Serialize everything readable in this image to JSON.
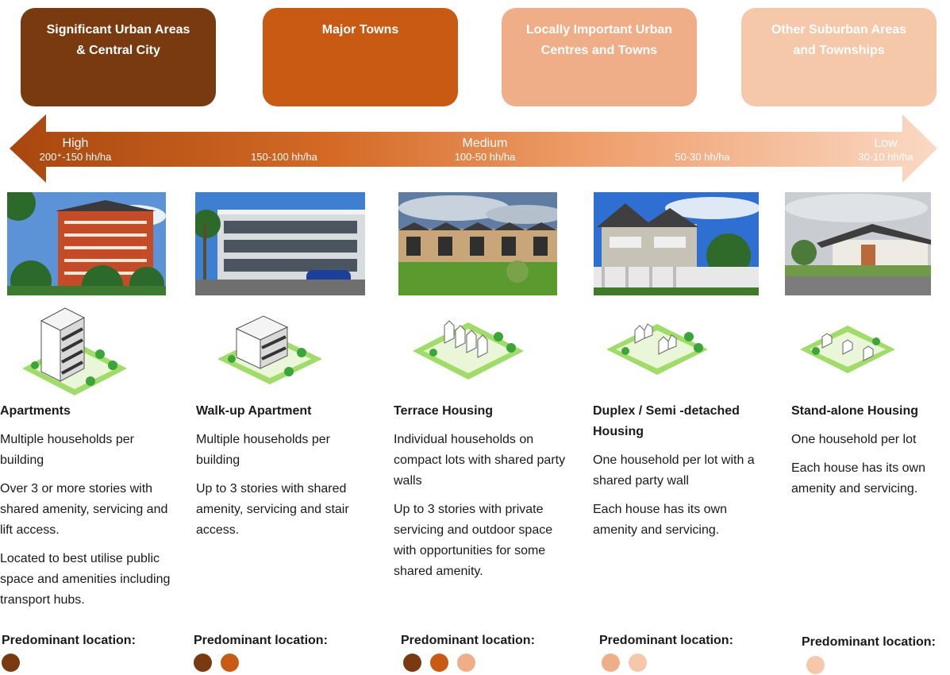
{
  "colors": {
    "significant": "#7a3a10",
    "major": "#c85a14",
    "locally": "#f0ae88",
    "other": "#f6c8aa"
  },
  "categories": [
    {
      "line1": "Significant Urban Areas",
      "line2": "& Central City",
      "color": "#7a3a10"
    },
    {
      "line1": "Major Towns",
      "line2": "",
      "color": "#c85a14"
    },
    {
      "line1": "Locally Important Urban",
      "line2": "Centres and Towns",
      "color": "#f0ae88"
    },
    {
      "line1": "Other Suburban Areas",
      "line2": "and Townships",
      "color": "#f6c8aa"
    }
  ],
  "density": [
    {
      "level": "High",
      "range": "200⁺-150 hh/ha"
    },
    {
      "level": "",
      "range": "150-100 hh/ha"
    },
    {
      "level": "Medium",
      "range": "100-50 hh/ha"
    },
    {
      "level": "",
      "range": "50-30 hh/ha"
    },
    {
      "level": "Low",
      "range": "30-10 hh/ha"
    }
  ],
  "typologies": [
    {
      "name": "Apartments",
      "paragraphs": [
        "Multiple households per building",
        "Over 3 or more stories with shared amenity, servicing and lift access.",
        "Located to best utilise public space and amenities including transport hubs."
      ],
      "location_label": "Predominant location:",
      "dots": [
        "#7a3a10"
      ]
    },
    {
      "name": "Walk-up Apartment",
      "paragraphs": [
        "Multiple households per building",
        "Up to 3 stories with shared amenity, servicing and stair access."
      ],
      "location_label": "Predominant location:",
      "dots": [
        "#7a3a10",
        "#c85a14"
      ]
    },
    {
      "name": "Terrace Housing",
      "paragraphs": [
        "Individual households on compact lots with shared party walls",
        "Up to 3 stories with private servicing and outdoor space with opportunities for some shared amenity."
      ],
      "location_label": "Predominant location:",
      "dots": [
        "#7a3a10",
        "#c85a14",
        "#f0ae88"
      ]
    },
    {
      "name": "Duplex / Semi -detached Housing",
      "paragraphs": [
        "One household per lot with a shared party wall",
        "Each house has its own amenity and servicing."
      ],
      "location_label": "Predominant location:",
      "dots": [
        "#f0ae88",
        "#f6c8aa"
      ]
    },
    {
      "name": "Stand-alone Housing",
      "paragraphs": [
        "One household per lot",
        "Each house has its own amenity and servicing."
      ],
      "location_label": "Predominant location:",
      "dots": [
        "#f6c8aa"
      ]
    }
  ]
}
